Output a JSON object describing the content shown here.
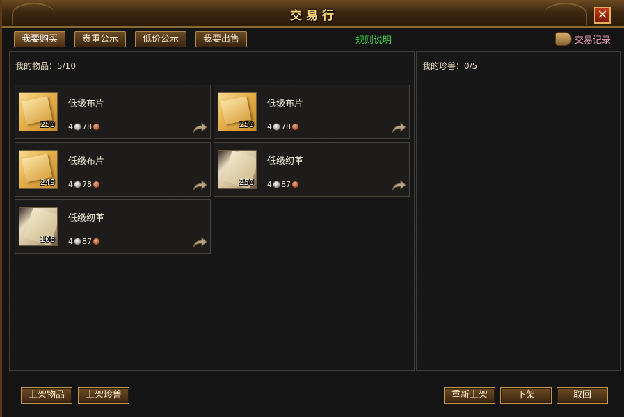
{
  "window": {
    "title": "交易行",
    "close_label": "✕"
  },
  "tabs": [
    {
      "label": "我要购买"
    },
    {
      "label": "贵重公示"
    },
    {
      "label": "低价公示"
    },
    {
      "label": "我要出售"
    }
  ],
  "rules_link": "规则说明",
  "records_label": "交易记录",
  "left_panel": {
    "header": "我的物品：5/10"
  },
  "right_panel": {
    "header": "我的珍兽：0/5"
  },
  "items": [
    {
      "name": "低级布片",
      "icon": "cloth-icon",
      "qty": "250",
      "price_silver": "4",
      "price_copper": "78"
    },
    {
      "name": "低级布片",
      "icon": "cloth-icon",
      "qty": "250",
      "price_silver": "4",
      "price_copper": "78"
    },
    {
      "name": "低级布片",
      "icon": "cloth-icon",
      "qty": "249",
      "price_silver": "4",
      "price_copper": "78"
    },
    {
      "name": "低级纫革",
      "icon": "leather-icon",
      "qty": "250",
      "price_silver": "4",
      "price_copper": "87"
    },
    {
      "name": "低级纫革",
      "icon": "leather-icon",
      "qty": "106",
      "price_silver": "4",
      "price_copper": "87"
    }
  ],
  "buttons": {
    "list_item": "上架物品",
    "list_pet": "上架珍兽",
    "relist": "重新上架",
    "delist": "下架",
    "retrieve": "取回"
  }
}
